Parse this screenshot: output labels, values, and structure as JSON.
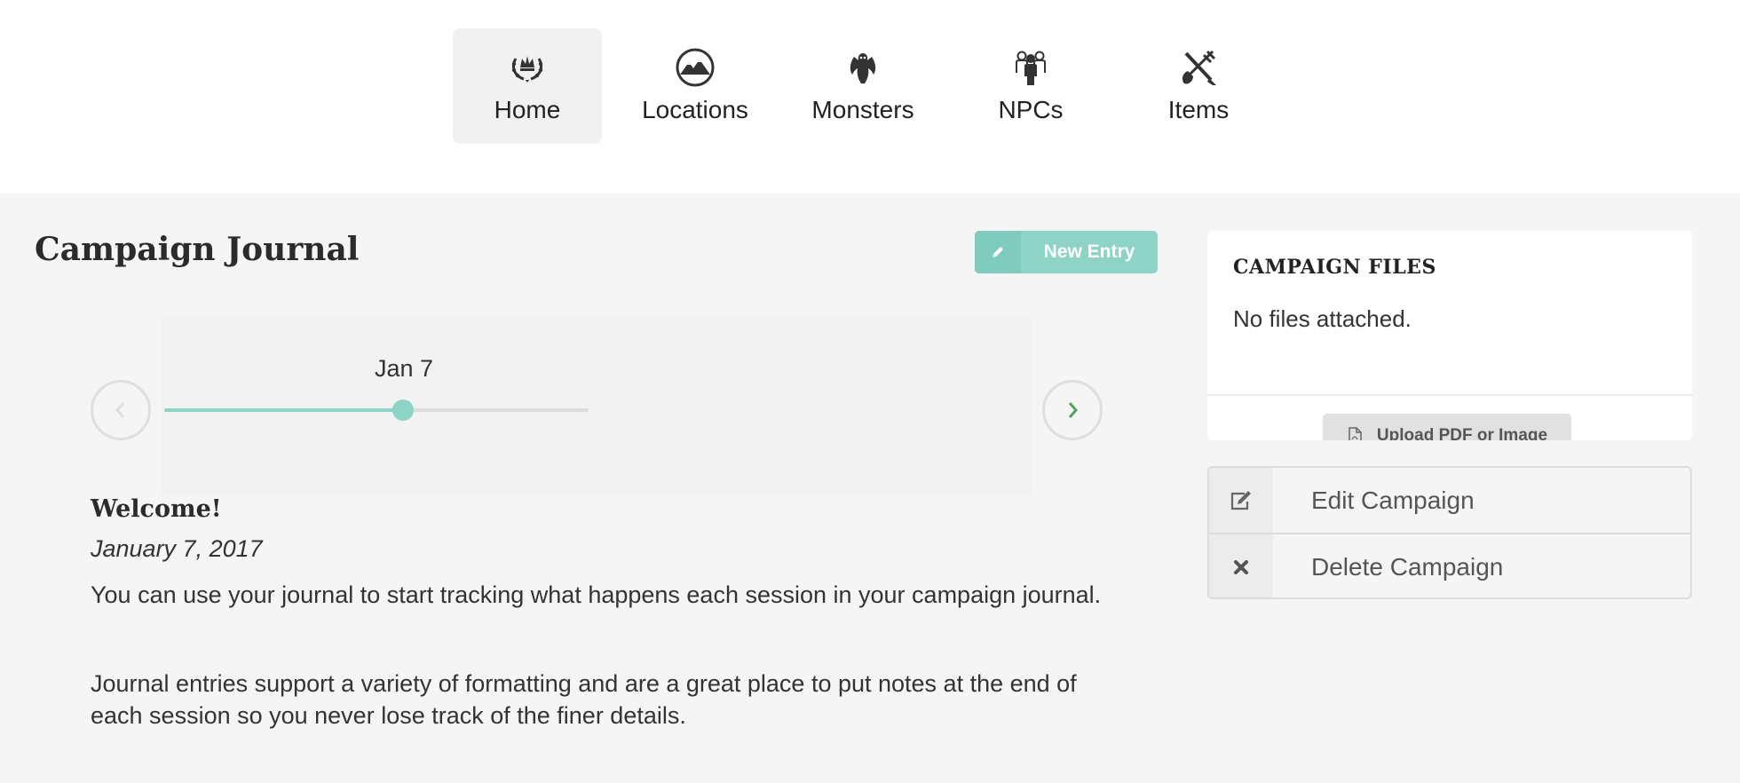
{
  "nav": {
    "items": [
      {
        "label": "Home",
        "icon": "crown-laurel-icon",
        "active": true
      },
      {
        "label": "Locations",
        "icon": "mountain-icon",
        "active": false
      },
      {
        "label": "Monsters",
        "icon": "dragon-icon",
        "active": false
      },
      {
        "label": "NPCs",
        "icon": "people-icon",
        "active": false
      },
      {
        "label": "Items",
        "icon": "crossed-weapons-icon",
        "active": false
      }
    ]
  },
  "journal": {
    "title": "Campaign Journal",
    "new_entry_label": "New Entry",
    "timeline": {
      "current_date": "Jan 7",
      "position": 0.56
    },
    "entry": {
      "title": "Welcome!",
      "date": "January 7, 2017",
      "paragraphs": [
        "You can use your journal to start tracking what happens each session in your campaign journal.",
        "Journal entries support a variety of formatting and are a great place to put notes at the end of each session so you never lose track of the finer details."
      ]
    }
  },
  "files": {
    "heading": "CAMPAIGN FILES",
    "empty_text": "No files attached.",
    "upload_label": "Upload PDF or Image"
  },
  "actions": {
    "edit_label": "Edit Campaign",
    "delete_label": "Delete Campaign"
  },
  "colors": {
    "accent": "#8dd3c6",
    "background": "#f5f5f5"
  }
}
